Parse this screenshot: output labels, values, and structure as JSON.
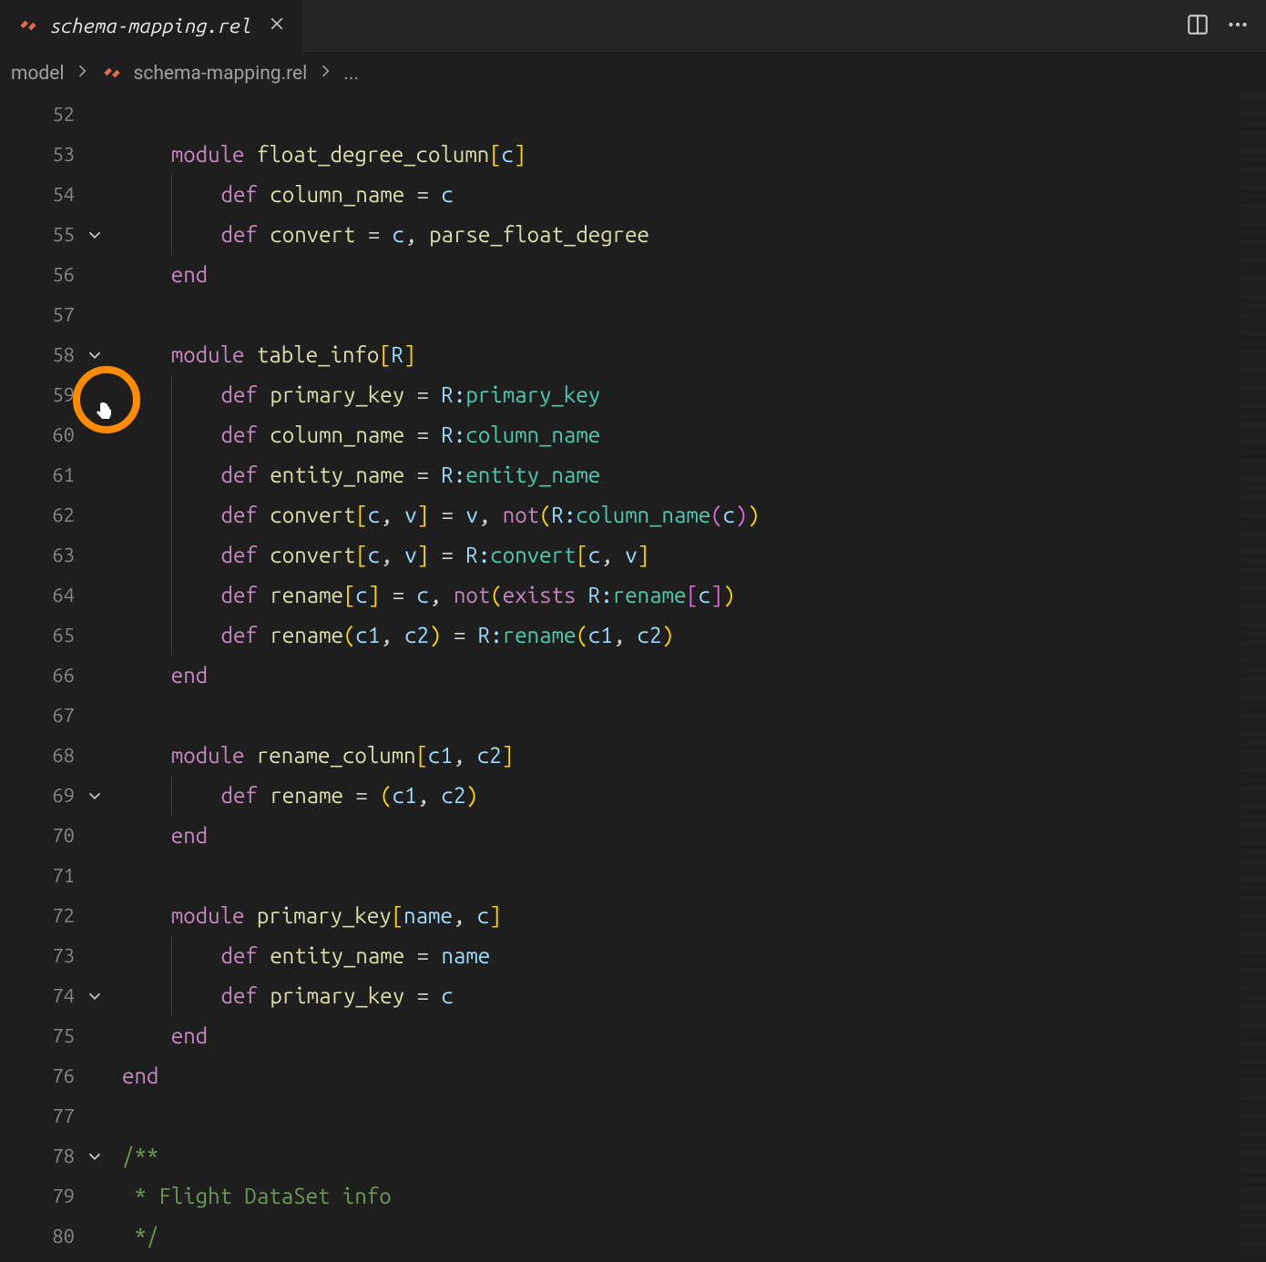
{
  "tab": {
    "filename": "schema-mapping.rel"
  },
  "breadcrumbs": {
    "seg0": "model",
    "seg1": "schema-mapping.rel",
    "seg2": "..."
  },
  "lines": {
    "52": "52",
    "53": "53",
    "54": "54",
    "55": "55",
    "56": "56",
    "57": "57",
    "58": "58",
    "59": "59",
    "60": "60",
    "61": "61",
    "62": "62",
    "63": "63",
    "64": "64",
    "65": "65",
    "66": "66",
    "67": "67",
    "68": "68",
    "69": "69",
    "70": "70",
    "71": "71",
    "72": "72",
    "73": "73",
    "74": "74",
    "75": "75",
    "76": "76",
    "77": "77",
    "78": "78",
    "79": "79",
    "80": "80"
  },
  "tok": {
    "module": "module",
    "def": "def",
    "end": "end",
    "not": "not",
    "exists": "exists",
    "float_degree_column": "float_degree_column",
    "column_name": "column_name",
    "convert": "convert",
    "parse_float_degree": "parse_float_degree",
    "table_info": "table_info",
    "primary_key": "primary_key",
    "entity_name": "entity_name",
    "rename": "rename",
    "rename_column": "rename_column",
    "name": "name",
    "c": "c",
    "v": "v",
    "c1": "c1",
    "c2": "c2",
    "R": "R",
    "eq": " = ",
    "Rcolon": "R:",
    "Rprimary_key": "primary_key",
    "Rcolumn_name": "column_name",
    "Rentity_name": "entity_name",
    "Rconvert": "convert",
    "Rrename": "rename",
    "comma": ", ",
    "cm_open": "/**",
    "cm_line": " * Flight DataSet info",
    "cm_close": " */"
  }
}
